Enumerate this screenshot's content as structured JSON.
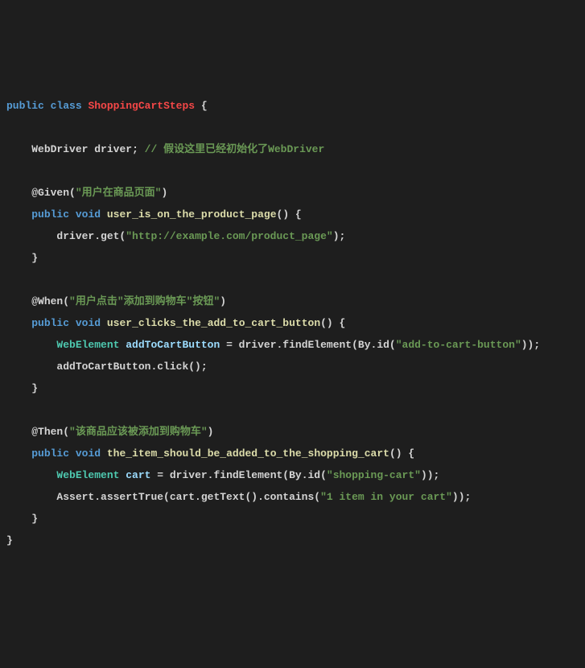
{
  "code": {
    "t1": "public",
    "t2": "class",
    "t3": "ShoppingCartSteps",
    "t4": " {",
    "blank": "",
    "indent1": "    ",
    "indent2": "        ",
    "t5": "WebDriver",
    "t6": "driver",
    "t7": "; ",
    "t8": "// 假设这里已经初始化了WebDriver",
    "t9": "@Given",
    "t10": "(",
    "t11": "\"用户在商品页面\"",
    "t12": ")",
    "t13": "void",
    "t14": "user_is_on_the_product_page",
    "t15": "() {",
    "t16": "driver.get(",
    "t17": "\"http://example.com/product_page\"",
    "t18": ");",
    "t19": "}",
    "t20": "@When",
    "t21": "\"用户点击\"添加到购物车\"按钮\"",
    "t22": "user_clicks_the_add_to_cart_button",
    "t23": "WebElement",
    "t24": "addToCartButton",
    "t25": " = driver.findElement(By.id(",
    "t26": "\"add-to-cart-button\"",
    "t27": "));",
    "t28": "addToCartButton.click();",
    "t29": "@Then",
    "t30": "\"该商品应该被添加到购物车\"",
    "t31": "the_item_should_be_added_to_the_shopping_cart",
    "t32": "cart",
    "t33": "\"shopping-cart\"",
    "t34": "Assert.assertTrue(cart.getText().contains(",
    "t35": "\"1 item in your cart\"",
    "t36": "    }"
  }
}
